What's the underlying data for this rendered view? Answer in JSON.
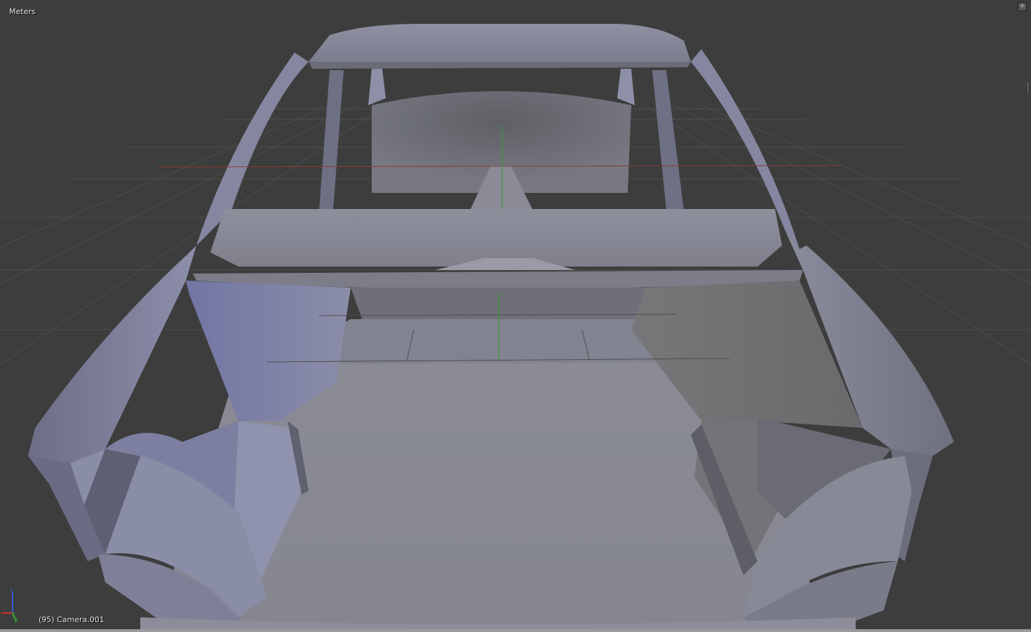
{
  "viewport": {
    "units_label": "Meters",
    "object_info": "(95) Camera.001",
    "corner_widget_glyph": "+",
    "background_color": "#3d3d3d",
    "grid_color": "#4e4e4e",
    "x_axis_color": "#8a3a3a",
    "y_axis_color": "#2aa52a",
    "mesh_color": "#8c8ea1"
  },
  "axis_gizmo": {
    "x_label": "x",
    "y_label": "y",
    "z_label": "z",
    "x_color": "#d22a2a",
    "y_color": "#2fbd2f",
    "z_color": "#3b5bd6"
  },
  "icons": {
    "corner": "expand-corner-icon",
    "gizmo": "axis-gizmo-icon",
    "handle": "resize-handle-icon"
  }
}
